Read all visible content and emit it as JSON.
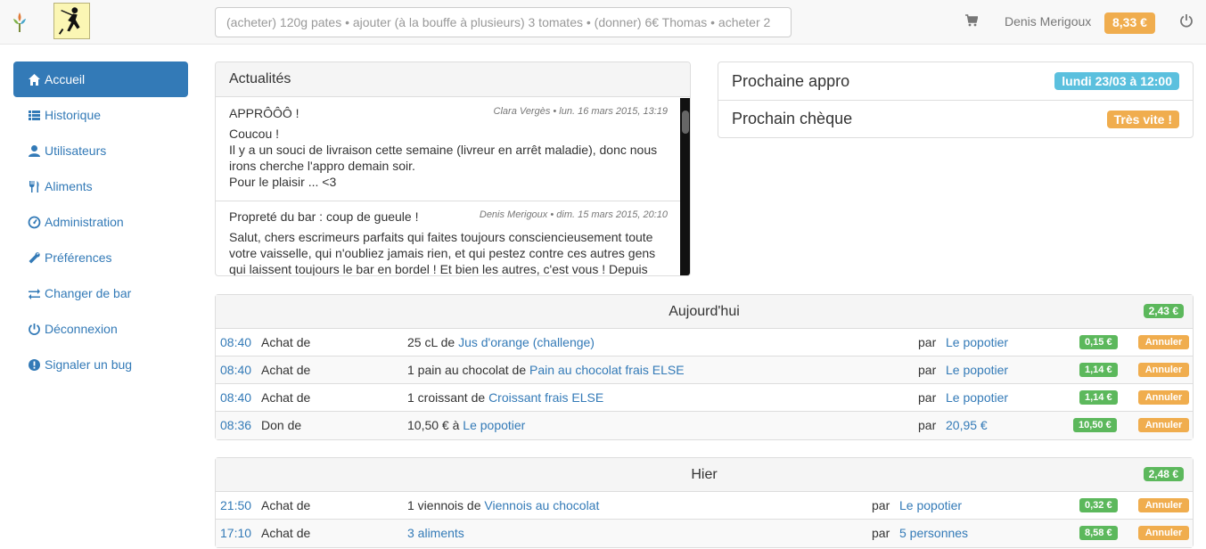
{
  "navbar": {
    "search_placeholder": "(acheter) 120g pates • ajouter (à la bouffe à plusieurs) 3 tomates • (donner) 6€ Thomas • acheter 2",
    "user_name": "Denis Merigoux",
    "balance": "8,33 €",
    "icons": [
      "brand-logo",
      "bar-logo",
      "shopping-cart-icon",
      "power-icon"
    ]
  },
  "sidebar": {
    "items": [
      {
        "label": "Accueil",
        "icon": "home-icon",
        "active": true
      },
      {
        "label": "Historique",
        "icon": "list-icon"
      },
      {
        "label": "Utilisateurs",
        "icon": "user-icon"
      },
      {
        "label": "Aliments",
        "icon": "cutlery-icon"
      },
      {
        "label": "Administration",
        "icon": "dashboard-icon"
      },
      {
        "label": "Préférences",
        "icon": "wrench-icon"
      },
      {
        "label": "Changer de bar",
        "icon": "transfer-icon"
      },
      {
        "label": "Déconnexion",
        "icon": "power-icon"
      },
      {
        "label": "Signaler un bug",
        "icon": "exclamation-sign-icon"
      }
    ]
  },
  "news": {
    "title": "Actualités",
    "items": [
      {
        "title": "APPRÔÔÔ !",
        "meta": "Clara Vergès • lun. 16 mars 2015, 13:19",
        "text": "Coucou !\nIl y a un souci de livraison cette semaine (livreur en arrêt maladie), donc nous irons cherche l'appro demain soir.\nPour le plaisir ... <3"
      },
      {
        "title": "Propreté du bar : coup de gueule !",
        "meta": "Denis Merigoux • dim. 15 mars 2015, 20:10",
        "text": "Salut, chers escrimeurs parfaits qui faites toujours consciencieusement toute votre vaisselle, qui n'oubliez jamais rien, et qui pestez contre ces autres gens qui laissent toujours le bar en bordel ! Et bien les autres, c'est vous ! Depuis"
      }
    ]
  },
  "appro": {
    "next_appro_label": "Prochaine appro",
    "next_appro_value": "lundi 23/03 à 12:00",
    "next_cheque_label": "Prochain chèque",
    "next_cheque_value": "Très vite !"
  },
  "today": {
    "title": "Aujourd'hui",
    "total": "2,43 €",
    "rows": [
      {
        "time": "08:40",
        "type": "Achat de",
        "desc_prefix": "25 cL de ",
        "desc_link": "Jus d'orange (challenge)",
        "par": "par",
        "who": "Le popotier",
        "amount": "0,15 €",
        "cancel": "Annuler"
      },
      {
        "time": "08:40",
        "type": "Achat de",
        "desc_prefix": "1 pain au chocolat de ",
        "desc_link": "Pain au chocolat frais ELSE",
        "par": "par",
        "who": "Le popotier",
        "amount": "1,14 €",
        "cancel": "Annuler"
      },
      {
        "time": "08:40",
        "type": "Achat de",
        "desc_prefix": "1 croissant de ",
        "desc_link": "Croissant frais ELSE",
        "par": "par",
        "who": "Le popotier",
        "amount": "1,14 €",
        "cancel": "Annuler"
      },
      {
        "time": "08:36",
        "type": "Don de",
        "desc_prefix": "10,50 € à ",
        "desc_link": "Le popotier",
        "par": "par",
        "who": "20,95 €",
        "amount": "10,50 €",
        "cancel": "Annuler"
      }
    ]
  },
  "yesterday": {
    "title": "Hier",
    "total": "2,48 €",
    "rows": [
      {
        "time": "21:50",
        "type": "Achat de",
        "desc_prefix": "1 viennois de ",
        "desc_link": "Viennois au chocolat",
        "par": "par",
        "who": "Le popotier",
        "amount": "0,32 €",
        "cancel": "Annuler"
      },
      {
        "time": "17:10",
        "type": "Achat de",
        "desc_prefix": "",
        "desc_link": "3 aliments",
        "par": "par",
        "who": "5 personnes",
        "amount": "8,58 €",
        "cancel": "Annuler"
      }
    ]
  }
}
